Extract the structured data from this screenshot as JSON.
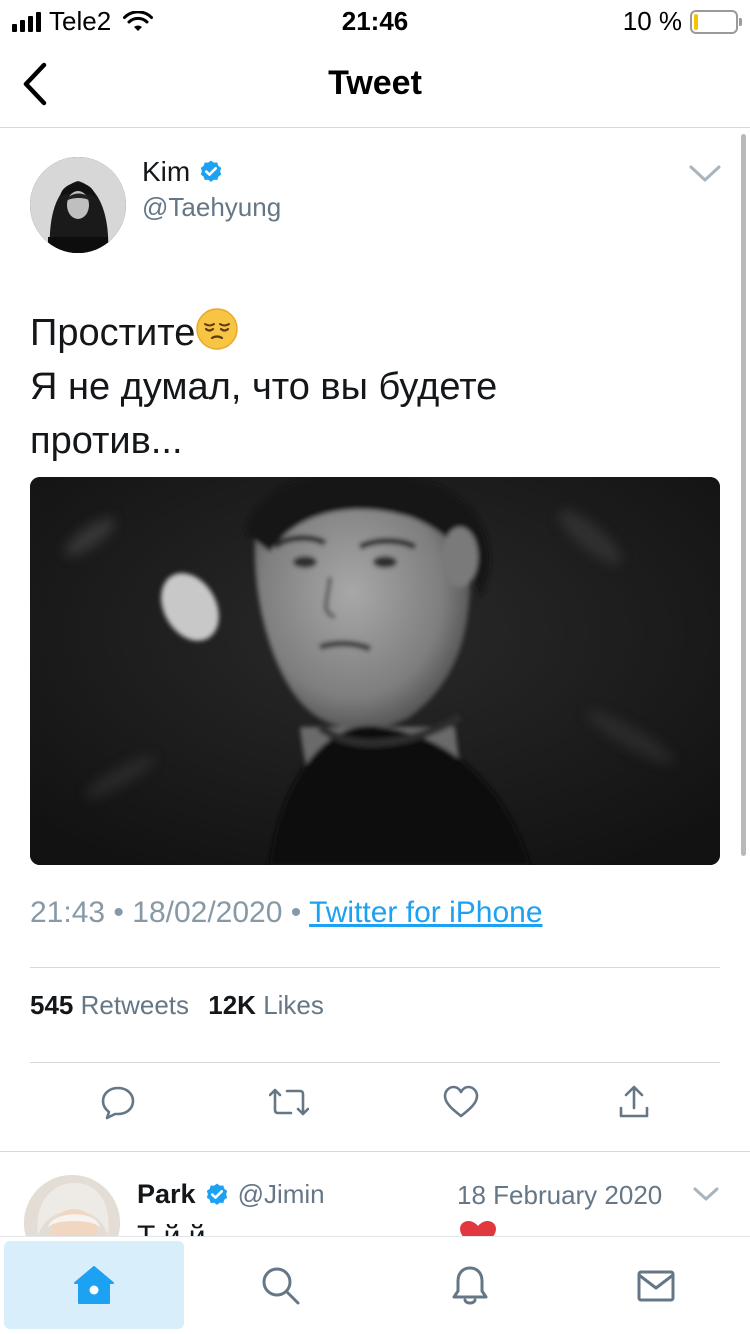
{
  "status_bar": {
    "carrier": "Tele2",
    "time": "21:46",
    "battery_percent_text": "10 %",
    "battery_level": 0.1,
    "signal_bars": 4
  },
  "header": {
    "title": "Tweet",
    "back_icon": "chevron-left-icon"
  },
  "tweet": {
    "author_name": "Kim",
    "author_handle": "@Taehyung",
    "text_line1": "Простите",
    "text_line2": "Я не думал, что вы будете",
    "text_line3": "против...",
    "emoji": "pensive-face",
    "timestamp_time": "21:43",
    "timestamp_date": "18/02/2020",
    "source": "Twitter for iPhone",
    "retweets_count": "545",
    "retweets_label": "Retweets",
    "likes_count": "12K",
    "likes_label": "Likes",
    "verified_color": "#1da1f2"
  },
  "reply": {
    "author_name": "Park",
    "author_handle": "@Jimin",
    "date": "18 February 2020",
    "text_visible": "Т   й          й"
  },
  "tab_bar": {
    "items": [
      "home-icon",
      "search-icon",
      "notifications-icon",
      "messages-icon"
    ],
    "active": "home"
  },
  "colors": {
    "accent": "#1da1f2",
    "secondary_text": "#657786",
    "divider": "#d8d8d8"
  }
}
